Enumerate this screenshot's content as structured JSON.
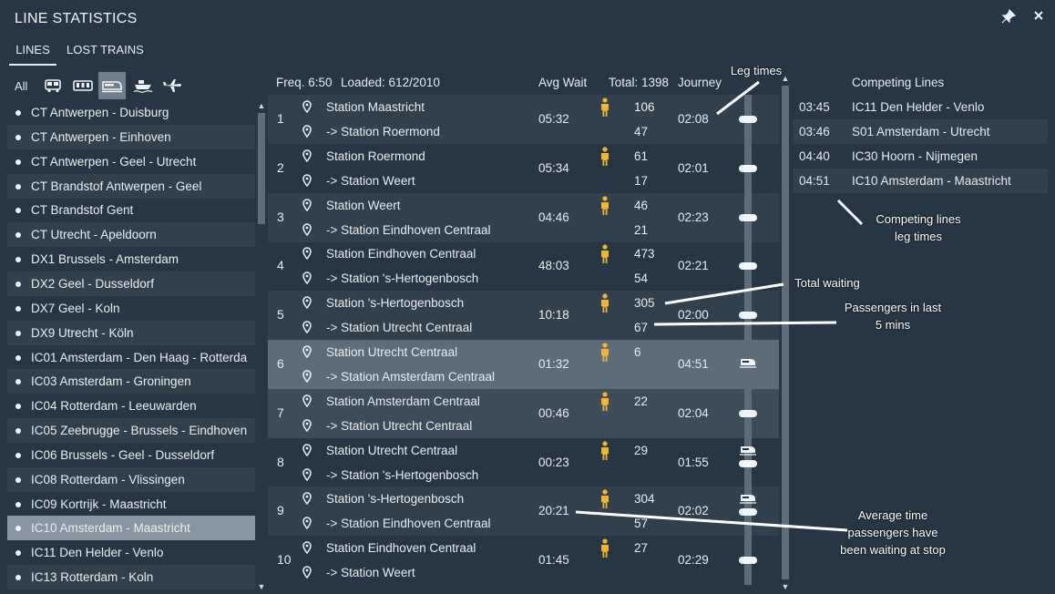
{
  "window": {
    "title": "LINE STATISTICS",
    "pin_icon": "pin-icon",
    "close_icon": "close-icon"
  },
  "tabs": [
    {
      "label": "LINES",
      "active": true
    },
    {
      "label": "LOST TRAINS",
      "active": false
    }
  ],
  "filters": {
    "all_label": "All",
    "icons": [
      "bus-icon",
      "tram-icon",
      "train-icon",
      "ship-icon",
      "plane-icon"
    ],
    "active": "train-icon"
  },
  "lines": [
    "CT Antwerpen - Duisburg",
    "CT Antwerpen - Einhoven",
    "CT Antwerpen - Geel - Utrecht",
    "CT Brandstof Antwerpen - Geel",
    "CT Brandstof Gent",
    "CT Utrecht - Apeldoorn",
    "DX1 Brussels - Amsterdam",
    "DX2 Geel - Dusseldorf",
    "DX7 Geel - Koln",
    "DX9 Utrecht - Köln",
    "IC01 Amsterdam - Den Haag - Rotterda",
    "IC03 Amsterdam - Groningen",
    "IC04 Rotterdam - Leeuwarden",
    "IC05 Zeebrugge - Brussels - Eindhoven",
    "IC06 Brussels - Geel - Dusseldorf",
    "IC08 Rotterdam - Vlissingen",
    "IC09 Kortrijk - Maastricht",
    "IC10 Amsterdam - Maastricht",
    "IC11 Den Helder - Venlo",
    "IC13 Rotterdam - Koln"
  ],
  "selected_line": "IC10 Amsterdam - Maastricht",
  "header": {
    "freq": "Freq. 6:50",
    "loaded": "Loaded: 612/2010",
    "avg_wait": "Avg Wait",
    "total": "Total: 1398",
    "journey": "Journey",
    "competing": "Competing Lines"
  },
  "stops": [
    {
      "num": "1",
      "from": "Station Maastricht",
      "to": "-> Station Roermond",
      "wait": "05:32",
      "total": "106",
      "recent": "47",
      "journey": "02:08",
      "vehicle": "pill"
    },
    {
      "num": "2",
      "from": "Station Roermond",
      "to": "-> Station Weert",
      "wait": "05:34",
      "total": "61",
      "recent": "17",
      "journey": "02:01",
      "vehicle": "pill"
    },
    {
      "num": "3",
      "from": "Station Weert",
      "to": "-> Station Eindhoven Centraal",
      "wait": "04:46",
      "total": "46",
      "recent": "21",
      "journey": "02:23",
      "vehicle": "pill"
    },
    {
      "num": "4",
      "from": "Station Eindhoven Centraal",
      "to": "-> Station 's-Hertogenbosch",
      "wait": "48:03",
      "total": "473",
      "recent": "54",
      "journey": "02:21",
      "vehicle": "pill"
    },
    {
      "num": "5",
      "from": "Station 's-Hertogenbosch",
      "to": "-> Station Utrecht Centraal",
      "wait": "10:18",
      "total": "305",
      "recent": "67",
      "journey": "02:00",
      "vehicle": "pill"
    },
    {
      "num": "6",
      "from": "Station Utrecht Centraal",
      "to": "-> Station Amsterdam Centraal",
      "wait": "01:32",
      "total": "6",
      "recent": "",
      "journey": "04:51",
      "vehicle": "train"
    },
    {
      "num": "7",
      "from": "Station Amsterdam Centraal",
      "to": "-> Station Utrecht Centraal",
      "wait": "00:46",
      "total": "22",
      "recent": "",
      "journey": "02:04",
      "vehicle": "pill"
    },
    {
      "num": "8",
      "from": "Station Utrecht Centraal",
      "to": "-> Station 's-Hertogenbosch",
      "wait": "00:23",
      "total": "29",
      "recent": "",
      "journey": "01:55",
      "vehicle": "train"
    },
    {
      "num": "9",
      "from": "Station 's-Hertogenbosch",
      "to": "-> Station Eindhoven Centraal",
      "wait": "20:21",
      "total": "304",
      "recent": "57",
      "journey": "02:02",
      "vehicle": "train"
    },
    {
      "num": "10",
      "from": "Station Eindhoven Centraal",
      "to": "-> Station Weert",
      "wait": "01:45",
      "total": "27",
      "recent": "",
      "journey": "02:29",
      "vehicle": "pill"
    }
  ],
  "competing": [
    {
      "time": "03:45",
      "name": "IC11 Den Helder - Venlo"
    },
    {
      "time": "03:46",
      "name": "S01 Amsterdam - Utrecht"
    },
    {
      "time": "04:40",
      "name": "IC30 Hoorn - Nijmegen"
    },
    {
      "time": "04:51",
      "name": "IC10 Amsterdam - Maastricht"
    }
  ],
  "annotations": {
    "leg_times": "Leg times",
    "competing_1": "Competing lines",
    "competing_2": "leg times",
    "total_waiting": "Total waiting",
    "recent_1": "Passengers in last",
    "recent_2": "5 mins",
    "avg_1": "Average time",
    "avg_2": "passengers have",
    "avg_3": "been waiting at stop"
  },
  "colors": {
    "background": "#263644",
    "selected_row": "#8796a2",
    "highlight_stop": "#5c6c79",
    "person": "#f2b531"
  }
}
